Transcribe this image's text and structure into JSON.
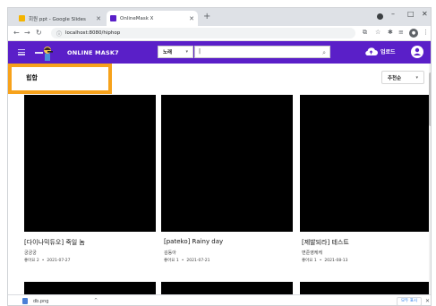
{
  "browser": {
    "tabs": [
      {
        "title": "회원 ppt - Google Slides",
        "favicon": "slides-icon",
        "color": "#f4b400",
        "active": false
      },
      {
        "title": "OnlineMask X",
        "favicon": "mask-icon",
        "color": "#5a1fc8",
        "active": true
      }
    ],
    "new_tab_label": "+",
    "url": "localhost:8080/hiphop"
  },
  "site": {
    "brand": "ONLINE MASK7",
    "search_category": "노래",
    "search_value": "|",
    "upload_label": "업로드",
    "header_color": "#5a1fc8"
  },
  "page": {
    "genre_title": "힙합",
    "sort_label": "추천순",
    "highlight_color": "#f7a21b"
  },
  "cards": [
    {
      "title": "[다이나믹듀오] 죽일 놈",
      "author": "궁궁궁",
      "likes": "좋아요 2",
      "date": "2021-07-27"
    },
    {
      "title": "[pateko] Rainy day",
      "author": "김동아",
      "likes": "좋아요 1",
      "date": "2021-07-21"
    },
    {
      "title": "[제발되라] 테스트",
      "author": "변준영케케",
      "likes": "좋아요 1",
      "date": "2021-08-13"
    }
  ],
  "download": {
    "filename": "db.png",
    "show_all": "모두 표시"
  }
}
